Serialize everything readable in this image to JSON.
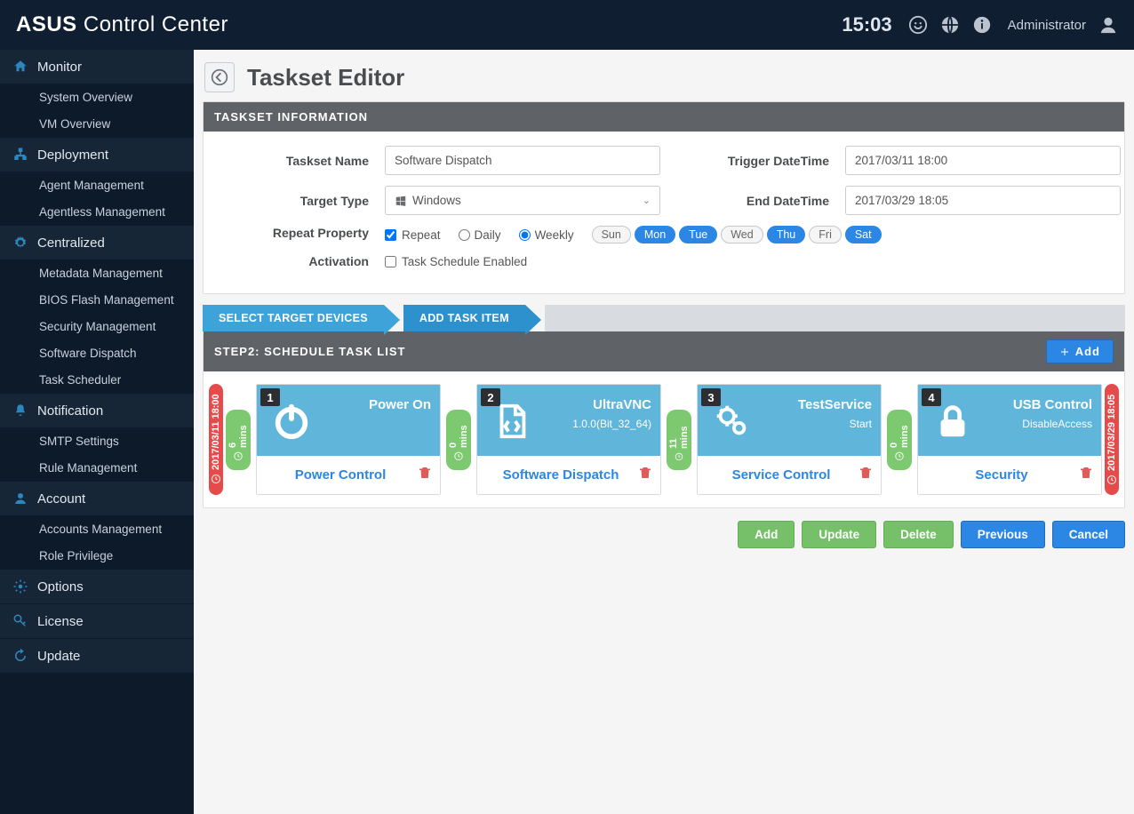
{
  "header": {
    "brand_a": "ASUS ",
    "brand_b": "Control ",
    "brand_c": "Center",
    "time": "15:03",
    "user": "Administrator"
  },
  "sidebar": {
    "sections": [
      {
        "label": "Monitor",
        "icon": "home",
        "items": [
          "System Overview",
          "VM Overview"
        ]
      },
      {
        "label": "Deployment",
        "icon": "sitemap",
        "items": [
          "Agent Management",
          "Agentless Management"
        ]
      },
      {
        "label": "Centralized",
        "icon": "gear",
        "items": [
          "Metadata Management",
          "BIOS Flash Management",
          "Security Management",
          "Software Dispatch",
          "Task Scheduler"
        ]
      },
      {
        "label": "Notification",
        "icon": "bell",
        "items": [
          "SMTP Settings",
          "Rule Management"
        ]
      },
      {
        "label": "Account",
        "icon": "user",
        "items": [
          "Accounts Management",
          "Role Privilege"
        ]
      },
      {
        "label": "Options",
        "icon": "cog",
        "items": []
      },
      {
        "label": "License",
        "icon": "key",
        "items": []
      },
      {
        "label": "Update",
        "icon": "refresh",
        "items": []
      }
    ]
  },
  "page": {
    "title": "Taskset Editor",
    "panel_header": "TASKSET INFORMATION",
    "labels": {
      "taskset_name": "Taskset Name",
      "target_type": "Target Type",
      "repeat_property": "Repeat Property",
      "activation": "Activation",
      "trigger_dt": "Trigger DateTime",
      "end_dt": "End DateTime"
    },
    "values": {
      "taskset_name": "Software Dispatch",
      "target_type": "Windows",
      "trigger_dt": "2017/03/11 18:00",
      "end_dt": "2017/03/29 18:05"
    },
    "repeat": {
      "repeat_label": "Repeat",
      "repeat_checked": true,
      "daily_label": "Daily",
      "weekly_label": "Weekly",
      "weekly_selected": true,
      "days": [
        {
          "label": "Sun",
          "on": false
        },
        {
          "label": "Mon",
          "on": true
        },
        {
          "label": "Tue",
          "on": true
        },
        {
          "label": "Wed",
          "on": false
        },
        {
          "label": "Thu",
          "on": true
        },
        {
          "label": "Fri",
          "on": false
        },
        {
          "label": "Sat",
          "on": true
        }
      ],
      "activation_label": "Task Schedule Enabled",
      "activation_checked": false
    },
    "crumb1": "SELECT TARGET DEVICES",
    "crumb2": "ADD TASK ITEM",
    "step_header": "STEP2: SCHEDULE TASK LIST",
    "add_label": "Add",
    "start_time": "2017/03/11 18:00",
    "end_time": "2017/03/29 18:05",
    "gaps": [
      "6 mins",
      "0 mins",
      "11 mins",
      "0 mins"
    ],
    "tasks": [
      {
        "num": "1",
        "title": "Power On",
        "sub": "",
        "cat": "Power Control",
        "icon": "power"
      },
      {
        "num": "2",
        "title": "UltraVNC",
        "sub": "1.0.0(Bit_32_64)",
        "cat": "Software Dispatch",
        "icon": "file"
      },
      {
        "num": "3",
        "title": "TestService",
        "sub": "Start",
        "cat": "Service Control",
        "icon": "gears"
      },
      {
        "num": "4",
        "title": "USB Control",
        "sub": "DisableAccess",
        "cat": "Security",
        "icon": "lock"
      }
    ],
    "footer": {
      "add": "Add",
      "update": "Update",
      "delete": "Delete",
      "previous": "Previous",
      "cancel": "Cancel"
    }
  }
}
